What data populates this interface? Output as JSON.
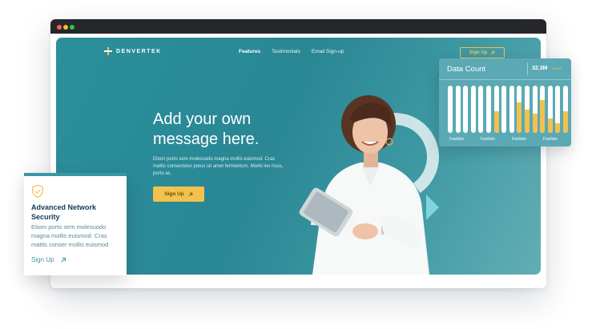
{
  "brand": {
    "name": "DENVERTEK",
    "accent": "#f2c14e",
    "primary": "#2a8794"
  },
  "nav": {
    "links": [
      {
        "label": "Features",
        "active": true
      },
      {
        "label": "Testimonials",
        "active": false
      },
      {
        "label": "Email Sign-up",
        "active": false
      }
    ],
    "signup_label": "Sign Up"
  },
  "hero": {
    "headline": "Add your own message here.",
    "body": "Etiom porto sem molesuodo magna mollis euismod. Cras mattis consectetur purus sit amet fermentum. Morbi leo risus, porto ac.",
    "button_label": "Sign Up"
  },
  "data_card": {
    "title": "Data Count",
    "stat": "32.3M",
    "stat_unit": "Users",
    "x_labels": [
      "Facilists",
      "Facilists",
      "Facilists",
      "Facilists"
    ],
    "bar_levels": [
      0,
      0,
      0,
      0,
      0,
      0,
      0.45,
      0,
      0,
      0.65,
      0.5,
      0.4,
      0.7,
      0.3,
      0.2,
      0.45
    ]
  },
  "security_card": {
    "title": "Advanced Network Security",
    "body": "Etiom porto sem molesuodo magna mollis euismod. Cras mattis conser mollis euismod",
    "link_label": "Sign Up",
    "icon": "shield-check-icon"
  }
}
